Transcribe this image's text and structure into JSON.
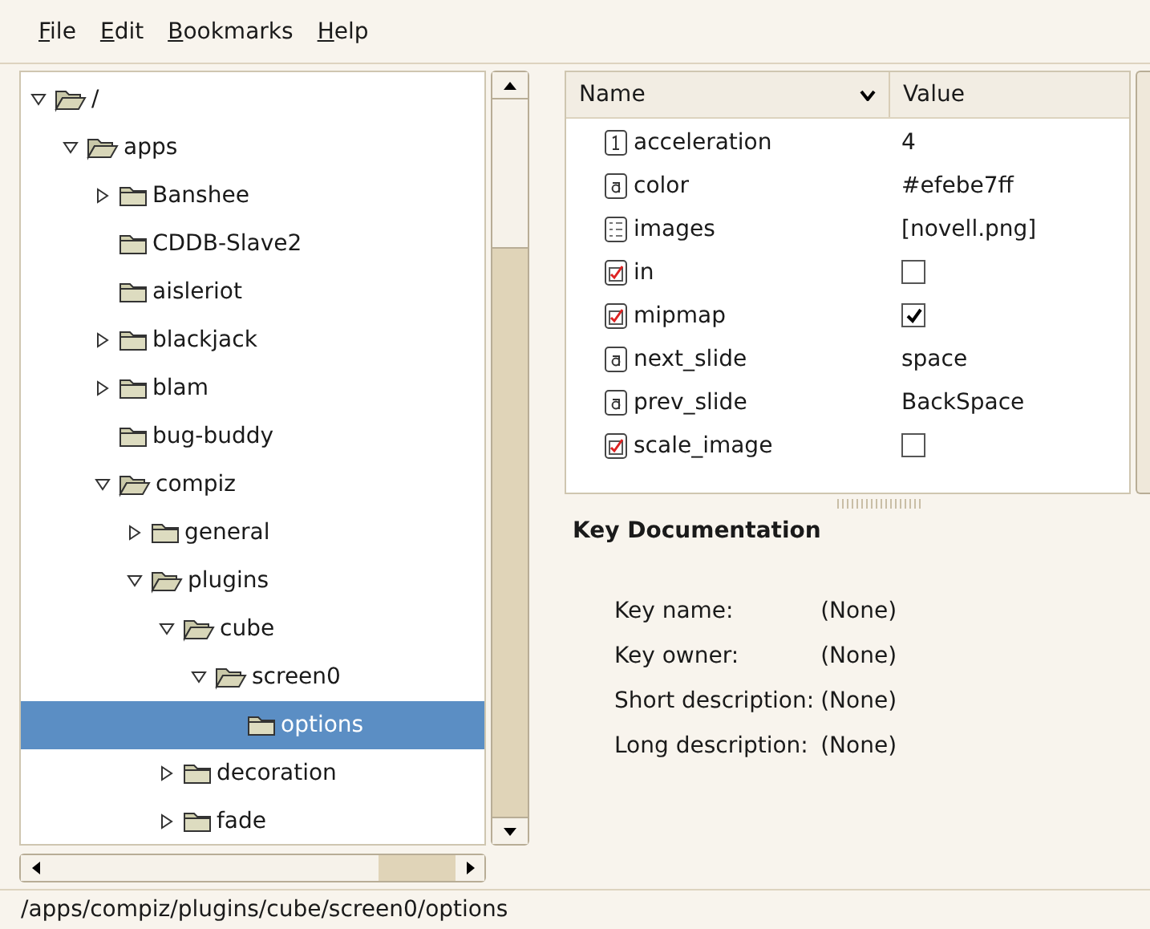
{
  "menu": [
    {
      "label": "File"
    },
    {
      "label": "Edit"
    },
    {
      "label": "Bookmarks"
    },
    {
      "label": "Help"
    }
  ],
  "tree": [
    {
      "label": "/",
      "expanded": true,
      "selected": false,
      "children": [
        {
          "label": "apps",
          "expanded": true,
          "selected": false,
          "children": [
            {
              "label": "Banshee",
              "expanded": false,
              "selected": false
            },
            {
              "label": "CDDB-Slave2",
              "selected": false
            },
            {
              "label": "aisleriot",
              "selected": false
            },
            {
              "label": "blackjack",
              "expanded": false,
              "selected": false
            },
            {
              "label": "blam",
              "expanded": false,
              "selected": false
            },
            {
              "label": "bug-buddy",
              "selected": false
            },
            {
              "label": "compiz",
              "expanded": true,
              "selected": false,
              "children": [
                {
                  "label": "general",
                  "expanded": false,
                  "selected": false
                },
                {
                  "label": "plugins",
                  "expanded": true,
                  "selected": false,
                  "children": [
                    {
                      "label": "cube",
                      "expanded": true,
                      "selected": false,
                      "children": [
                        {
                          "label": "screen0",
                          "expanded": true,
                          "selected": false,
                          "children": [
                            {
                              "label": "options",
                              "selected": true
                            }
                          ]
                        }
                      ]
                    },
                    {
                      "label": "decoration",
                      "expanded": false,
                      "selected": false
                    },
                    {
                      "label": "fade",
                      "expanded": false,
                      "selected": false
                    }
                  ]
                }
              ]
            }
          ]
        }
      ]
    }
  ],
  "keys": {
    "columns": [
      "Name",
      "Value"
    ],
    "rows": [
      {
        "kind": "int",
        "name": "acceleration",
        "value": "4"
      },
      {
        "kind": "string",
        "name": "color",
        "value": "#efebe7ff"
      },
      {
        "kind": "list",
        "name": "images",
        "value": "[novell.png]"
      },
      {
        "kind": "bool",
        "name": "in",
        "checked": false
      },
      {
        "kind": "bool",
        "name": "mipmap",
        "checked": true
      },
      {
        "kind": "string",
        "name": "next_slide",
        "value": "space"
      },
      {
        "kind": "string",
        "name": "prev_slide",
        "value": "BackSpace"
      },
      {
        "kind": "bool",
        "name": "scale_image",
        "checked": false
      }
    ]
  },
  "documentation": {
    "title": "Key Documentation",
    "fields": [
      {
        "label": "Key name:",
        "value": "(None)"
      },
      {
        "label": "Key owner:",
        "value": "(None)"
      },
      {
        "label": "Short description:",
        "value": "(None)"
      },
      {
        "label": "Long description:",
        "value": "(None)"
      }
    ]
  },
  "status_bar": "/apps/compiz/plugins/cube/screen0/options"
}
